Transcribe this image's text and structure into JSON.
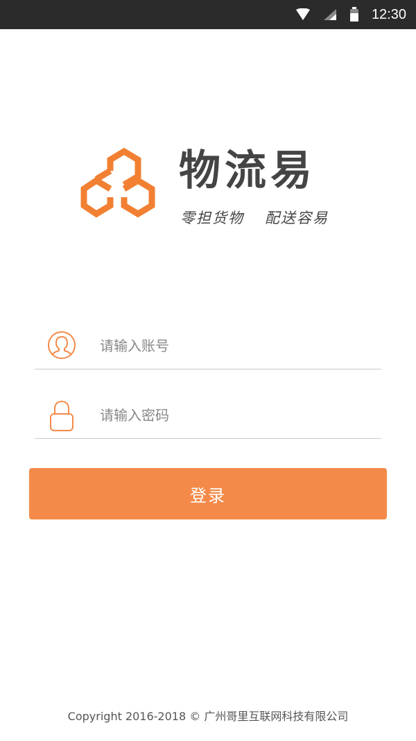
{
  "status_bar": {
    "time": "12:30",
    "icons": [
      "wifi-icon",
      "signal-icon",
      "battery-icon"
    ]
  },
  "brand": {
    "title": "物流易",
    "slogan_part1": "零担货物",
    "slogan_part2": "配送容易",
    "logo_icon": "hexagon-logo-icon"
  },
  "form": {
    "account": {
      "placeholder": "请输入账号",
      "value": "",
      "icon": "user-icon"
    },
    "password": {
      "placeholder": "请输入密码",
      "value": "",
      "icon": "lock-icon"
    },
    "login_label": "登录"
  },
  "footer": {
    "copyright": "Copyright 2016-2018 © 广州哥里互联网科技有限公司"
  },
  "colors": {
    "accent": "#f48a49",
    "status_bar": "#2b2b2b",
    "text_dark": "#444444"
  }
}
